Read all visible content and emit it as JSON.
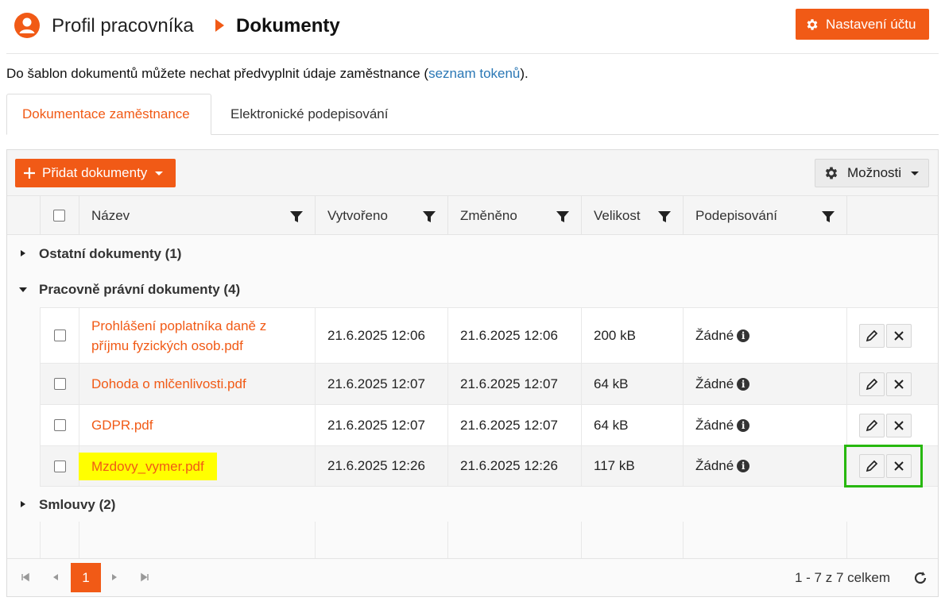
{
  "header": {
    "crumb_profile": "Profil pracovníka",
    "crumb_current": "Dokumenty",
    "settings_button": "Nastavení účtu"
  },
  "intro": {
    "text_before": "Do šablon dokumentů můžete nechat předvyplnit údaje zaměstnance (",
    "link": "seznam tokenů",
    "text_after": ")."
  },
  "tabs": [
    "Dokumentace zaměstnance",
    "Elektronické podepisování"
  ],
  "toolbar": {
    "add_button": "Přidat dokumenty",
    "options_button": "Možnosti"
  },
  "columns": [
    "Název",
    "Vytvořeno",
    "Změněno",
    "Velikost",
    "Podepisování"
  ],
  "groups": [
    {
      "label": "Ostatní dokumenty (1)",
      "expanded": false
    },
    {
      "label": "Pracovně právní dokumenty (4)",
      "expanded": true
    },
    {
      "label": "Smlouvy (2)",
      "expanded": false
    }
  ],
  "rows": [
    {
      "name": "Prohlášení poplatníka daně z příjmu fyzických osob.pdf",
      "created": "21.6.2025 12:06",
      "modified": "21.6.2025 12:06",
      "size": "200 kB",
      "signing": "Žádné"
    },
    {
      "name": "Dohoda o mlčenlivosti.pdf",
      "created": "21.6.2025 12:07",
      "modified": "21.6.2025 12:07",
      "size": "64 kB",
      "signing": "Žádné"
    },
    {
      "name": "GDPR.pdf",
      "created": "21.6.2025 12:07",
      "modified": "21.6.2025 12:07",
      "size": "64 kB",
      "signing": "Žádné"
    },
    {
      "name": "Mzdovy_vymer.pdf",
      "created": "21.6.2025 12:26",
      "modified": "21.6.2025 12:26",
      "size": "117 kB",
      "signing": "Žádné"
    }
  ],
  "pager": {
    "current_page": "1",
    "info": "1 - 7 z 7 celkem"
  },
  "colors": {
    "accent": "#f15a16",
    "highlight": "#ffff00",
    "green_box": "#27b80e"
  }
}
